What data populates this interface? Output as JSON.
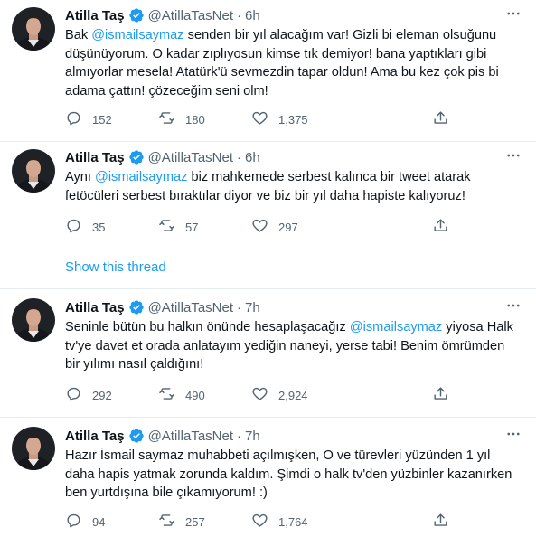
{
  "tweets": [
    {
      "name": "Atilla Taş",
      "handle": "@AtillaTasNet",
      "time": "6h",
      "lines": [
        {
          "pre": "Bak ",
          "mention": "@ismailsaymaz",
          "post": "  senden bir yıl alacağım var! Gizli bi eleman olsuğunu"
        },
        {
          "pre": "düşünüyorum. O kadar zıplıyosun kimse tık demiyor! bana yaptıkları gibi",
          "mention": "",
          "post": ""
        },
        {
          "pre": "almıyorlar mesela! Atatürk'ü sevmezdin tapar oldun! Ama bu kez çok pis bi",
          "mention": "",
          "post": ""
        },
        {
          "pre": "adama çattın! çözeceğim seni olm!",
          "mention": "",
          "post": ""
        }
      ],
      "replies": "152",
      "retweets": "180",
      "likes": "1,375"
    },
    {
      "name": "Atilla Taş",
      "handle": "@AtillaTasNet",
      "time": "6h",
      "lines": [
        {
          "pre": "Aynı ",
          "mention": "@ismailsaymaz",
          "post": "  biz mahkemede serbest kalınca bir tweet atarak"
        },
        {
          "pre": "fetöcüleri serbest bıraktılar diyor ve biz bir yıl daha hapiste kalıyoruz!",
          "mention": "",
          "post": ""
        }
      ],
      "replies": "35",
      "retweets": "57",
      "likes": "297",
      "show_thread": "Show this thread"
    },
    {
      "name": "Atilla Taş",
      "handle": "@AtillaTasNet",
      "time": "7h",
      "lines": [
        {
          "pre": "Seninle bütün bu halkın önünde hesaplaşacağız ",
          "mention": "@ismailsaymaz",
          "post": " yiyosa Halk"
        },
        {
          "pre": "tv'ye davet et orada anlatayım yediğin naneyi, yerse tabi! Benim ömrümden",
          "mention": "",
          "post": ""
        },
        {
          "pre": "bir yılımı nasıl çaldığını!",
          "mention": "",
          "post": ""
        }
      ],
      "replies": "292",
      "retweets": "490",
      "likes": "2,924"
    },
    {
      "name": "Atilla Taş",
      "handle": "@AtillaTasNet",
      "time": "7h",
      "lines": [
        {
          "pre": "Hazır İsmail saymaz muhabbeti açılmışken, O ve türevleri yüzünden 1 yıl",
          "mention": "",
          "post": ""
        },
        {
          "pre": "daha hapis yatmak zorunda kaldım. Şimdi o halk tv'den yüzbinler kazanırken",
          "mention": "",
          "post": ""
        },
        {
          "pre": "ben yurtdışına bile çıkamıyorum! :)",
          "mention": "",
          "post": ""
        }
      ],
      "replies": "94",
      "retweets": "257",
      "likes": "1,764"
    }
  ],
  "colors": {
    "accent": "#1d9bf0",
    "text": "#0f1419",
    "muted": "#536471",
    "divider": "#e6ecf0"
  },
  "icons": [
    "verified-badge-icon",
    "more-icon",
    "reply-icon",
    "retweet-icon",
    "like-icon",
    "share-icon"
  ]
}
